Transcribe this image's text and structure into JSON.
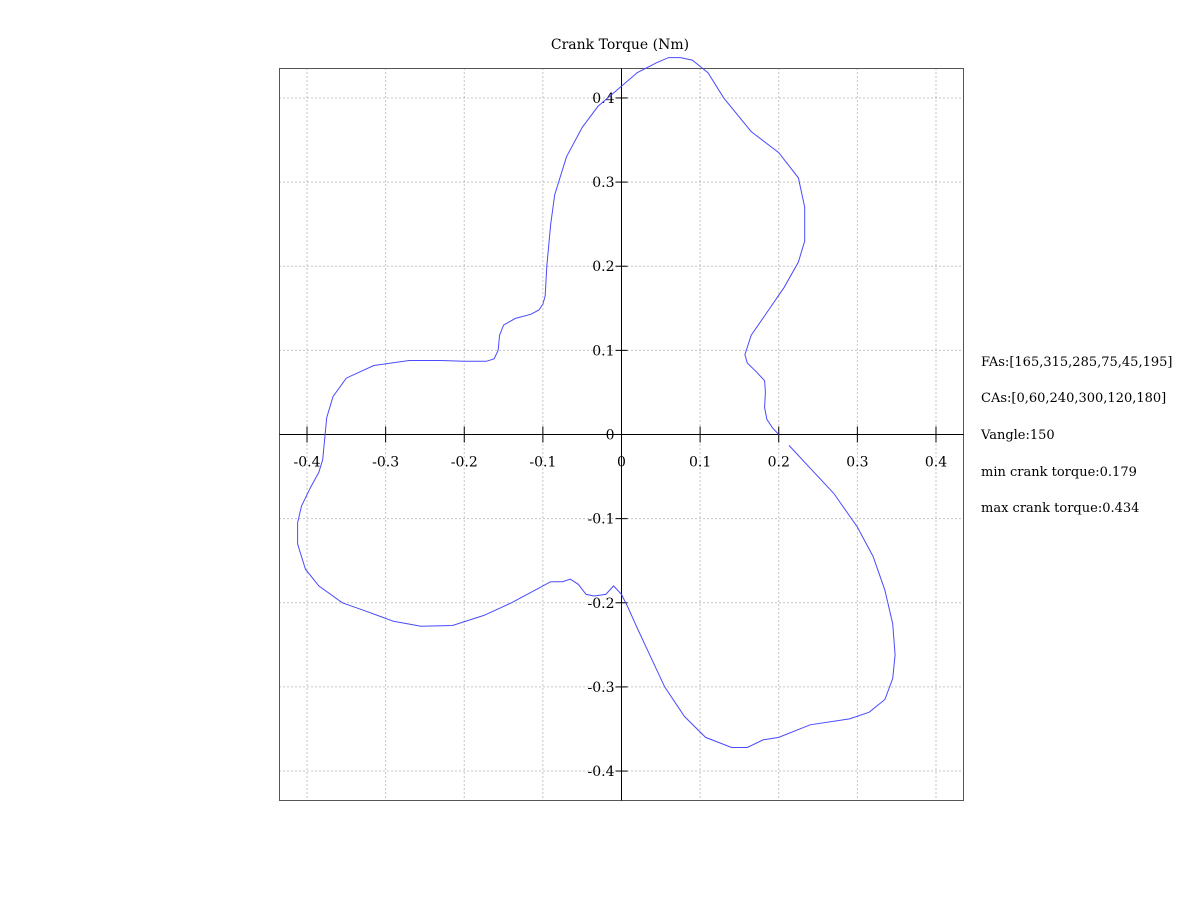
{
  "chart_data": {
    "type": "line",
    "title": "Crank Torque (Nm)",
    "xlabel": "",
    "ylabel": "",
    "xlim": [
      -0.435,
      0.435
    ],
    "ylim": [
      -0.435,
      0.435
    ],
    "grid": true,
    "x_ticks": [
      -0.4,
      -0.3,
      -0.2,
      -0.1,
      0,
      0.1,
      0.2,
      0.3,
      0.4
    ],
    "x_tick_labels": [
      "-0.4",
      "-0.3",
      "-0.2",
      "-0.1",
      "0",
      "0.1",
      "0.2",
      "0.3",
      "0.4"
    ],
    "y_ticks": [
      0.4,
      0.3,
      0.2,
      0.1,
      0,
      -0.1,
      -0.2,
      -0.3,
      -0.4
    ],
    "y_tick_labels": [
      "0.4",
      "0.3",
      "0.2",
      "0.1",
      "0",
      "-0.1",
      "-0.2",
      "-0.3",
      "-0.4"
    ],
    "series": [
      {
        "color": "#4a4aff",
        "x": [
          0.213,
          0.24,
          0.27,
          0.3,
          0.32,
          0.335,
          0.345,
          0.348,
          0.345,
          0.335,
          0.315,
          0.29,
          0.24,
          0.2,
          0.18,
          0.16,
          0.14,
          0.107,
          0.08,
          0.055,
          0.035,
          0.02,
          0.008,
          0.0,
          -0.01,
          -0.02,
          -0.035,
          -0.045,
          -0.055,
          -0.065,
          -0.075,
          -0.09,
          -0.11,
          -0.14,
          -0.175,
          -0.215,
          -0.255,
          -0.29,
          -0.325,
          -0.355,
          -0.385,
          -0.402,
          -0.412,
          -0.412,
          -0.407,
          -0.395,
          -0.385,
          -0.38,
          -0.378,
          -0.375,
          -0.367,
          -0.35,
          -0.315,
          -0.27,
          -0.23,
          -0.2,
          -0.172,
          -0.162,
          -0.157,
          -0.155,
          -0.15,
          -0.135,
          -0.115,
          -0.105,
          -0.1,
          -0.097,
          -0.095,
          -0.09,
          -0.085,
          -0.07,
          -0.05,
          -0.03,
          -0.005,
          0.02,
          0.045,
          0.06,
          0.075,
          0.09,
          0.11,
          0.13,
          0.165,
          0.2,
          0.225,
          0.233,
          0.233,
          0.225,
          0.207,
          0.185,
          0.165,
          0.157,
          0.16,
          0.172,
          0.182,
          0.183,
          0.182,
          0.185,
          0.192,
          0.2
        ],
        "y": [
          -0.013,
          -0.04,
          -0.07,
          -0.11,
          -0.145,
          -0.185,
          -0.225,
          -0.262,
          -0.29,
          -0.315,
          -0.33,
          -0.338,
          -0.345,
          -0.36,
          -0.363,
          -0.372,
          -0.372,
          -0.36,
          -0.335,
          -0.3,
          -0.26,
          -0.23,
          -0.205,
          -0.19,
          -0.18,
          -0.19,
          -0.192,
          -0.19,
          -0.178,
          -0.172,
          -0.175,
          -0.175,
          -0.185,
          -0.2,
          -0.215,
          -0.227,
          -0.228,
          -0.222,
          -0.21,
          -0.2,
          -0.18,
          -0.16,
          -0.13,
          -0.105,
          -0.085,
          -0.062,
          -0.045,
          -0.03,
          -0.01,
          0.02,
          0.045,
          0.067,
          0.082,
          0.088,
          0.088,
          0.087,
          0.087,
          0.09,
          0.1,
          0.118,
          0.13,
          0.138,
          0.143,
          0.148,
          0.155,
          0.165,
          0.2,
          0.25,
          0.285,
          0.33,
          0.365,
          0.39,
          0.41,
          0.43,
          0.442,
          0.448,
          0.448,
          0.445,
          0.43,
          0.4,
          0.36,
          0.335,
          0.305,
          0.27,
          0.23,
          0.205,
          0.175,
          0.145,
          0.118,
          0.095,
          0.085,
          0.074,
          0.064,
          0.05,
          0.032,
          0.018,
          0.008,
          0.0
        ]
      }
    ]
  },
  "annotations": {
    "fas": "FAs:[165,315,285,75,45,195]",
    "cas": "CAs:[0,60,240,300,120,180]",
    "vangle": "Vangle:150",
    "min_torque": "min crank torque:0.179",
    "max_torque": "max crank torque:0.434"
  }
}
